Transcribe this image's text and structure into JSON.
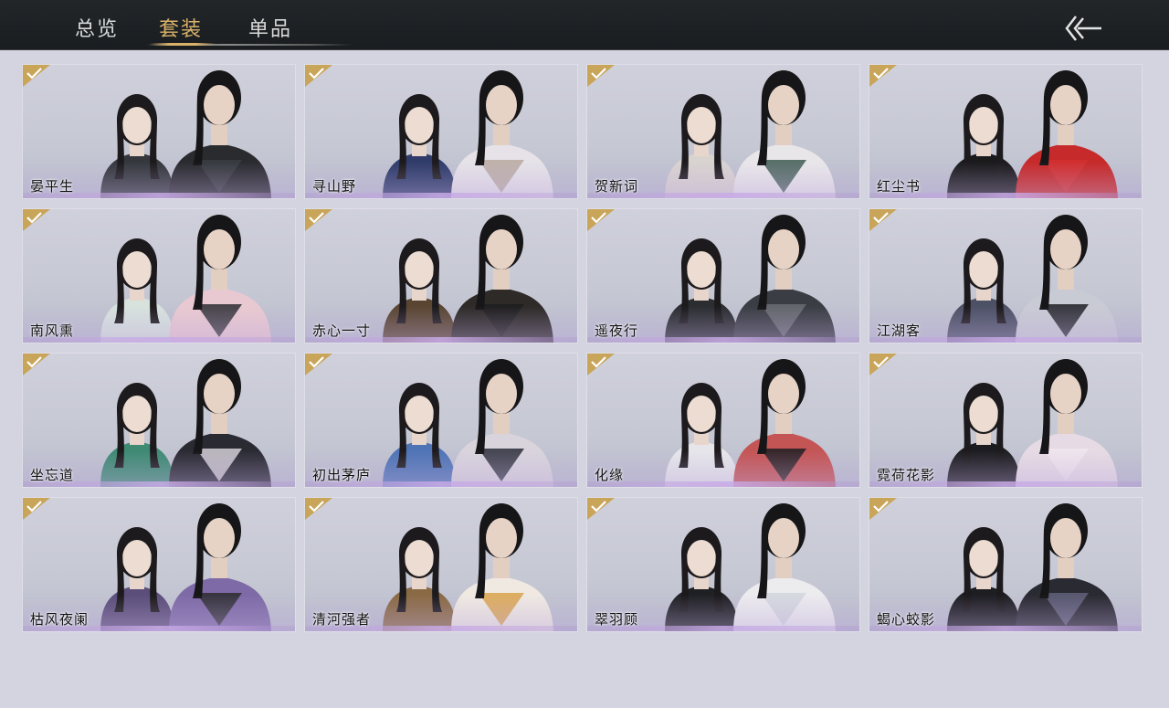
{
  "tabs": [
    {
      "label": "总览",
      "active": false
    },
    {
      "label": "套装",
      "active": true
    },
    {
      "label": "单品",
      "active": false
    }
  ],
  "back_icon": "back-arrow-icon",
  "colors": {
    "accent": "#d9b26a",
    "owned_badge": "#c9a55a",
    "card_glow": "#c8aae6"
  },
  "outfits": [
    {
      "name": "晏平生",
      "owned": true
    },
    {
      "name": "寻山野",
      "owned": true
    },
    {
      "name": "贺新词",
      "owned": true
    },
    {
      "name": "红尘书",
      "owned": true
    },
    {
      "name": "南风熏",
      "owned": true
    },
    {
      "name": "赤心一寸",
      "owned": true
    },
    {
      "name": "遥夜行",
      "owned": true
    },
    {
      "name": "江湖客",
      "owned": true
    },
    {
      "name": "坐忘道",
      "owned": true
    },
    {
      "name": "初出茅庐",
      "owned": true
    },
    {
      "name": "化缘",
      "owned": true
    },
    {
      "name": "霓荷花影",
      "owned": true
    },
    {
      "name": "枯风夜阑",
      "owned": true
    },
    {
      "name": "清河强者",
      "owned": true
    },
    {
      "name": "翠羽顾",
      "owned": true
    },
    {
      "name": "蝎心蛟影",
      "owned": true
    }
  ]
}
